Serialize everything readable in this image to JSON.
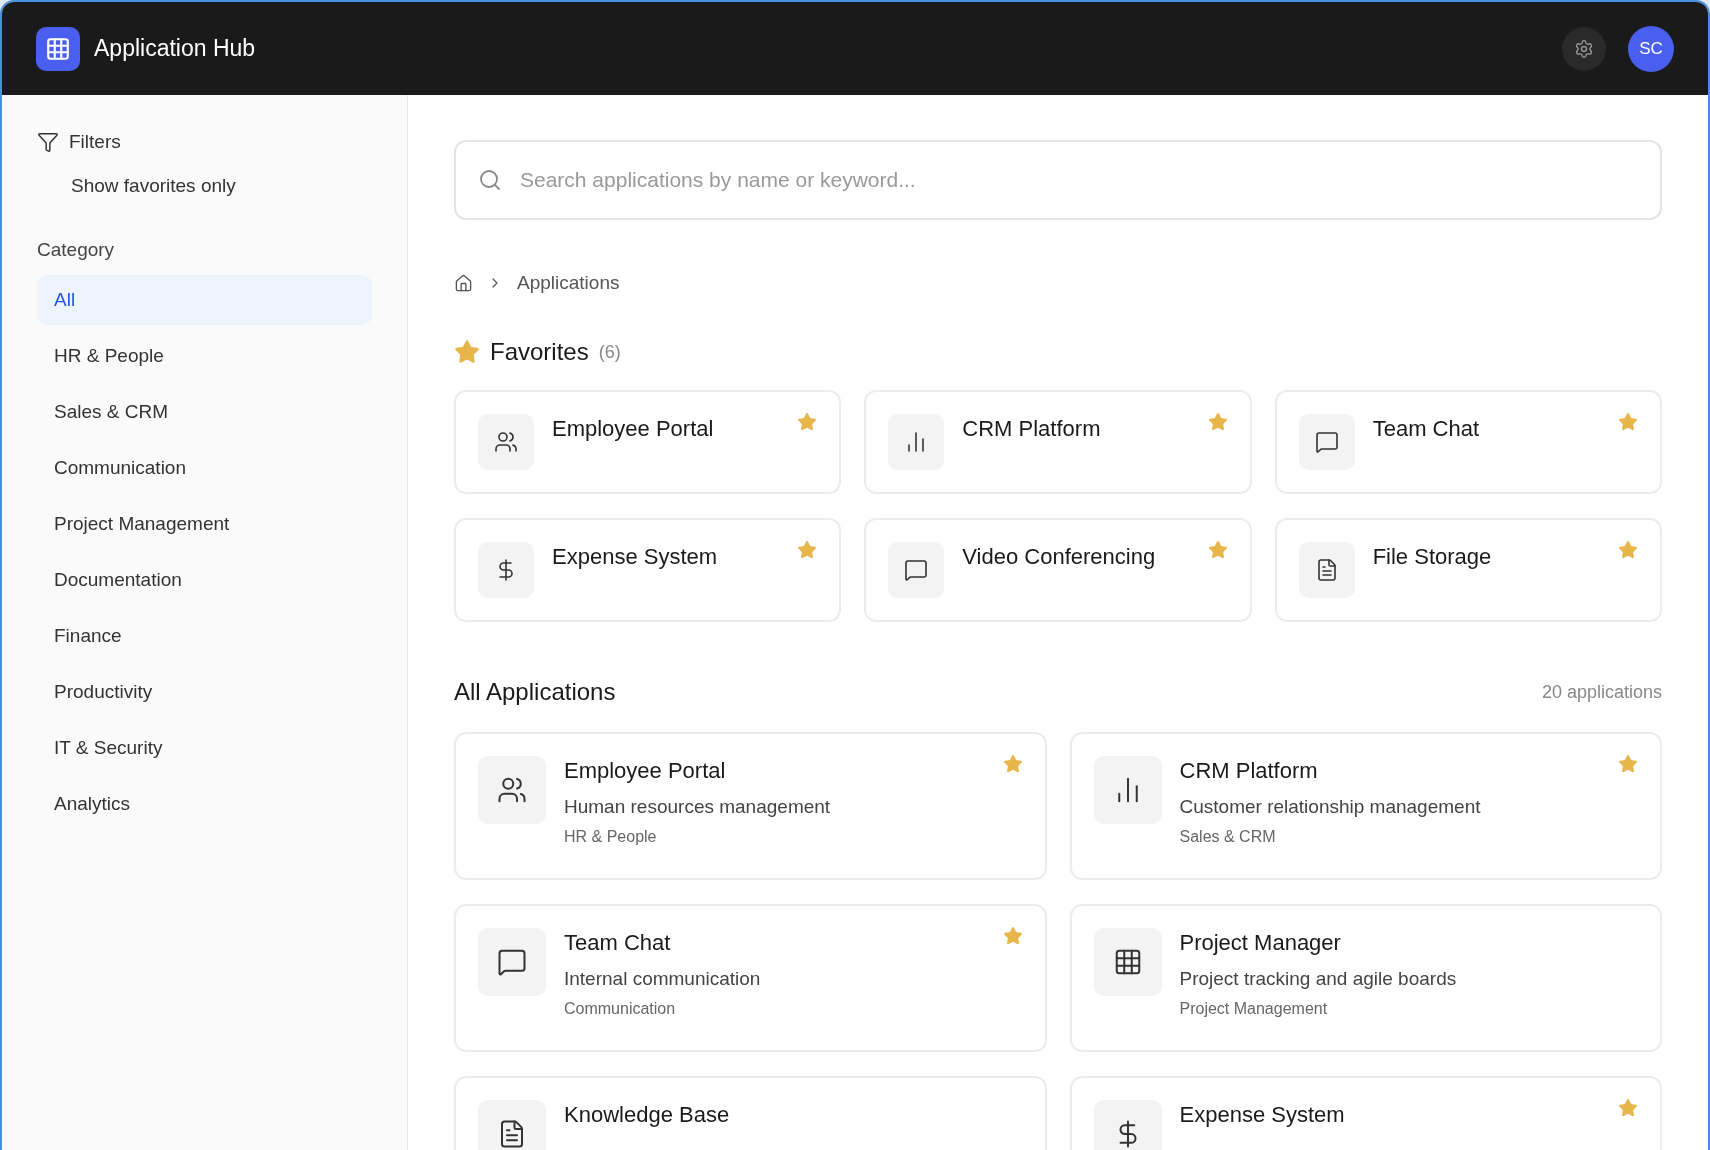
{
  "header": {
    "title": "Application Hub",
    "avatar": "SC"
  },
  "sidebar": {
    "filters_label": "Filters",
    "favorites_toggle": "Show favorites only",
    "category_label": "Category",
    "categories": [
      {
        "label": "All",
        "selected": true
      },
      {
        "label": "HR & People",
        "selected": false
      },
      {
        "label": "Sales & CRM",
        "selected": false
      },
      {
        "label": "Communication",
        "selected": false
      },
      {
        "label": "Project Management",
        "selected": false
      },
      {
        "label": "Documentation",
        "selected": false
      },
      {
        "label": "Finance",
        "selected": false
      },
      {
        "label": "Productivity",
        "selected": false
      },
      {
        "label": "IT & Security",
        "selected": false
      },
      {
        "label": "Analytics",
        "selected": false
      }
    ]
  },
  "search": {
    "placeholder": "Search applications by name or keyword..."
  },
  "breadcrumb": {
    "current": "Applications"
  },
  "favorites": {
    "title": "Favorites",
    "count": "(6)",
    "items": [
      {
        "name": "Employee Portal",
        "kind": "users",
        "favorite": true
      },
      {
        "name": "CRM Platform",
        "kind": "chart",
        "favorite": true
      },
      {
        "name": "Team Chat",
        "kind": "chat",
        "favorite": true
      },
      {
        "name": "Expense System",
        "kind": "dollar",
        "favorite": true
      },
      {
        "name": "Video Conferencing",
        "kind": "chat",
        "favorite": true
      },
      {
        "name": "File Storage",
        "kind": "doc",
        "favorite": true
      }
    ]
  },
  "all_apps": {
    "title": "All Applications",
    "count": "20 applications",
    "items": [
      {
        "name": "Employee Portal",
        "description": "Human resources management",
        "category": "HR & People",
        "kind": "users",
        "favorite": true
      },
      {
        "name": "CRM Platform",
        "description": "Customer relationship management",
        "category": "Sales & CRM",
        "kind": "chart",
        "favorite": true
      },
      {
        "name": "Team Chat",
        "description": "Internal communication",
        "category": "Communication",
        "kind": "chat",
        "favorite": true
      },
      {
        "name": "Project Manager",
        "description": "Project tracking and agile boards",
        "category": "Project Management",
        "kind": "grid",
        "favorite": false
      },
      {
        "name": "Knowledge Base",
        "kind": "doc",
        "favorite": false
      },
      {
        "name": "Expense System",
        "kind": "dollar",
        "favorite": true
      }
    ]
  }
}
